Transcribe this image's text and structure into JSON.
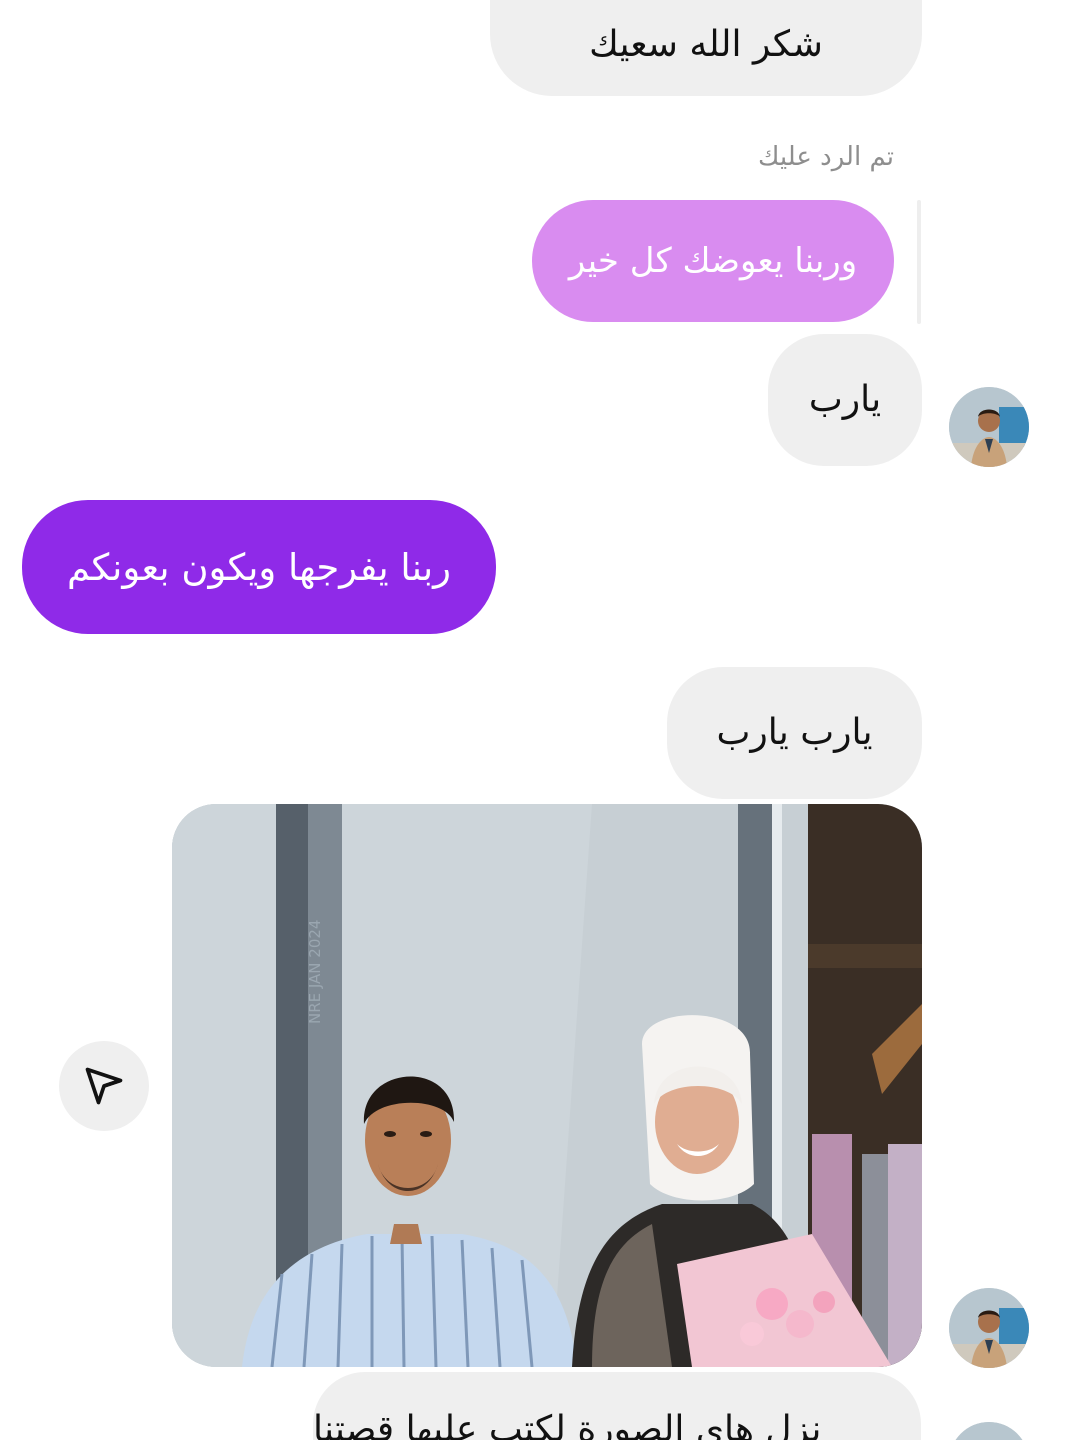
{
  "messages": [
    {
      "id": "msg-1",
      "from": "them",
      "text": "شكر الله سعيك"
    },
    {
      "id": "msg-2",
      "from": "me",
      "quoted": true,
      "text": "وربنا يعوضك كل خير"
    },
    {
      "id": "msg-3",
      "from": "them",
      "text": "يارب"
    },
    {
      "id": "msg-4",
      "from": "me",
      "text": "ربنا يفرجها ويكون بعونكم"
    },
    {
      "id": "msg-5",
      "from": "them",
      "text": "يارب يارب"
    },
    {
      "id": "msg-6",
      "from": "them",
      "text": "نزل هاي الصورة لكتب عليها قصتنا"
    }
  ],
  "reply_caption": "تم الرد عليك",
  "photo_message": {
    "from": "them",
    "photo_text": "NRE JAN 2024"
  },
  "icons": {
    "share": "paper-plane-icon",
    "avatar": "user-avatar"
  },
  "colors": {
    "outgoing_bubble": "#8f2ae8",
    "quoted_bubble": "#d98cf0",
    "incoming_bubble": "#efefef",
    "caption": "#8e8e8e"
  }
}
